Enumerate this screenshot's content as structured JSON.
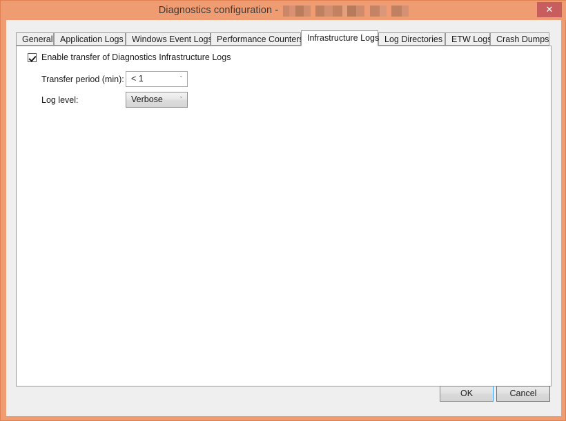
{
  "window": {
    "title_prefix": "Diagnostics configuration -",
    "title_redacted": "",
    "close_icon": "close-icon",
    "close_label": "✕",
    "accent_color": "#ef9c72",
    "close_button_color": "#c85d5d"
  },
  "tabs": [
    {
      "label": "General",
      "active": false
    },
    {
      "label": "Application Logs",
      "active": false
    },
    {
      "label": "Windows Event Logs",
      "active": false
    },
    {
      "label": "Performance Counters",
      "active": false
    },
    {
      "label": "Infrastructure Logs",
      "active": true
    },
    {
      "label": "Log Directories",
      "active": false
    },
    {
      "label": "ETW Logs",
      "active": false
    },
    {
      "label": "Crash Dumps",
      "active": false
    }
  ],
  "panel": {
    "enable_checkbox": {
      "label": "Enable transfer of Diagnostics Infrastructure Logs",
      "checked": true
    },
    "fields": [
      {
        "label": "Transfer period (min):",
        "value": "< 1",
        "style": "editable",
        "chevron": "ˇ"
      },
      {
        "label": "Log level:",
        "value": "Verbose",
        "style": "dropdown",
        "chevron": "ˇ"
      }
    ]
  },
  "footer": {
    "ok_label": "OK",
    "cancel_label": "Cancel",
    "focus_color": "#3399ff"
  }
}
